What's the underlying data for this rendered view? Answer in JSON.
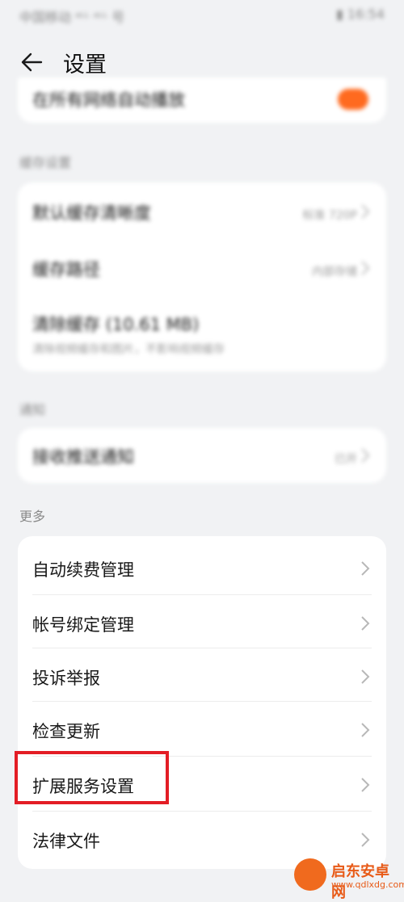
{
  "status_bar": {
    "left": "中国移动 ᵃᴸᴸ ᵃᴸᴸ 号",
    "right": "▮ 16:54"
  },
  "header": {
    "title": "设置"
  },
  "top_partial": {
    "label": "在所有网络自动播放"
  },
  "sections": [
    {
      "title": "缓存设置",
      "items": [
        {
          "label": "默认缓存清晰度",
          "value": "标准 720P"
        },
        {
          "label": "缓存路径",
          "value": "内部存储"
        },
        {
          "label": "清除缓存 (10.61 MB)",
          "sub": "清除视频缓存和图片，不影响视频缓存"
        }
      ]
    },
    {
      "title": "通知",
      "items": [
        {
          "label": "接收推送通知",
          "value": "已开"
        }
      ]
    },
    {
      "title": "更多",
      "items": [
        {
          "label": "自动续费管理"
        },
        {
          "label": "帐号绑定管理"
        },
        {
          "label": "投诉举报"
        },
        {
          "label": "检查更新"
        },
        {
          "label": "扩展服务设置"
        },
        {
          "label": "法律文件"
        }
      ]
    }
  ],
  "watermark": {
    "name": "启东安卓网",
    "url": "www.qdlxdg.com"
  },
  "colors": {
    "toggle_on": "#ff6a1f",
    "highlight": "#e31d25"
  }
}
